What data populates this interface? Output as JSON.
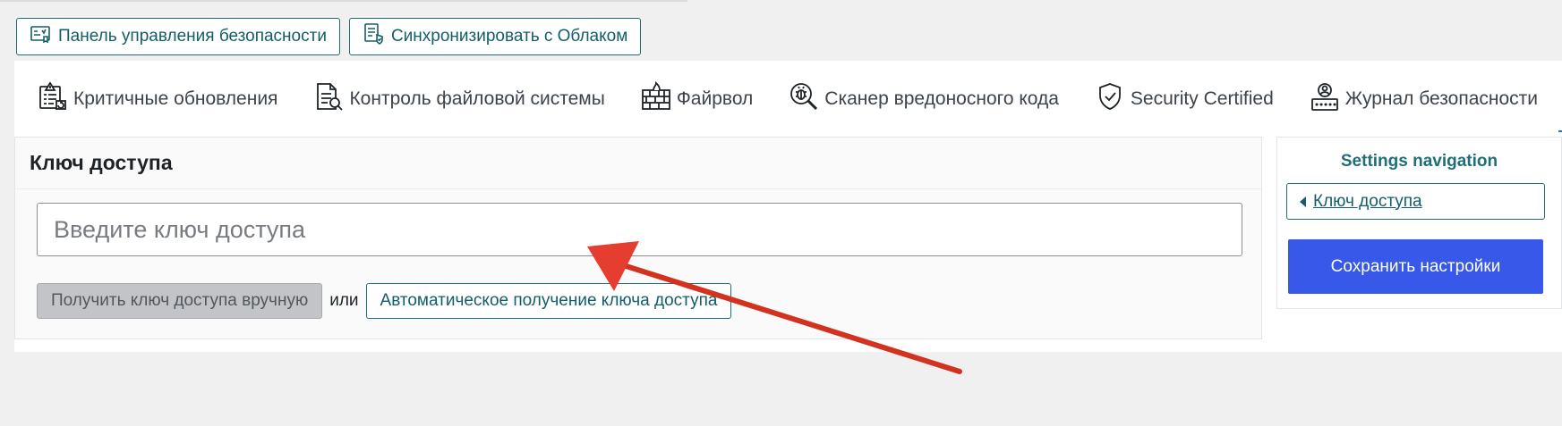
{
  "top_actions": {
    "dashboard_label": "Панель управления безопасности",
    "sync_label": "Синхронизировать с Облаком"
  },
  "tabs": [
    {
      "label": "Критичные обновления",
      "icon": "critical-updates-icon"
    },
    {
      "label": "Контроль файловой системы",
      "icon": "file-system-icon"
    },
    {
      "label": "Файрвол",
      "icon": "firewall-icon"
    },
    {
      "label": "Сканер вредоносного кода",
      "icon": "malware-scanner-icon"
    },
    {
      "label": "Security Certified",
      "icon": "shield-check-icon"
    },
    {
      "label": "Журнал безопасности",
      "icon": "security-log-icon"
    }
  ],
  "main": {
    "title": "Ключ доступа",
    "key_input_placeholder": "Введите ключ доступа",
    "key_input_value": "",
    "manual_button": "Получить ключ доступа вручную",
    "or_text": "или",
    "auto_button": "Автоматическое получение ключа доступа"
  },
  "sidebar": {
    "title": "Settings navigation",
    "link": "Ключ доступа",
    "save_button": "Сохранить настройки"
  },
  "colors": {
    "accent_teal": "#1f6f78",
    "save_blue": "#3858e9",
    "annotation_red": "#e53d2f"
  }
}
